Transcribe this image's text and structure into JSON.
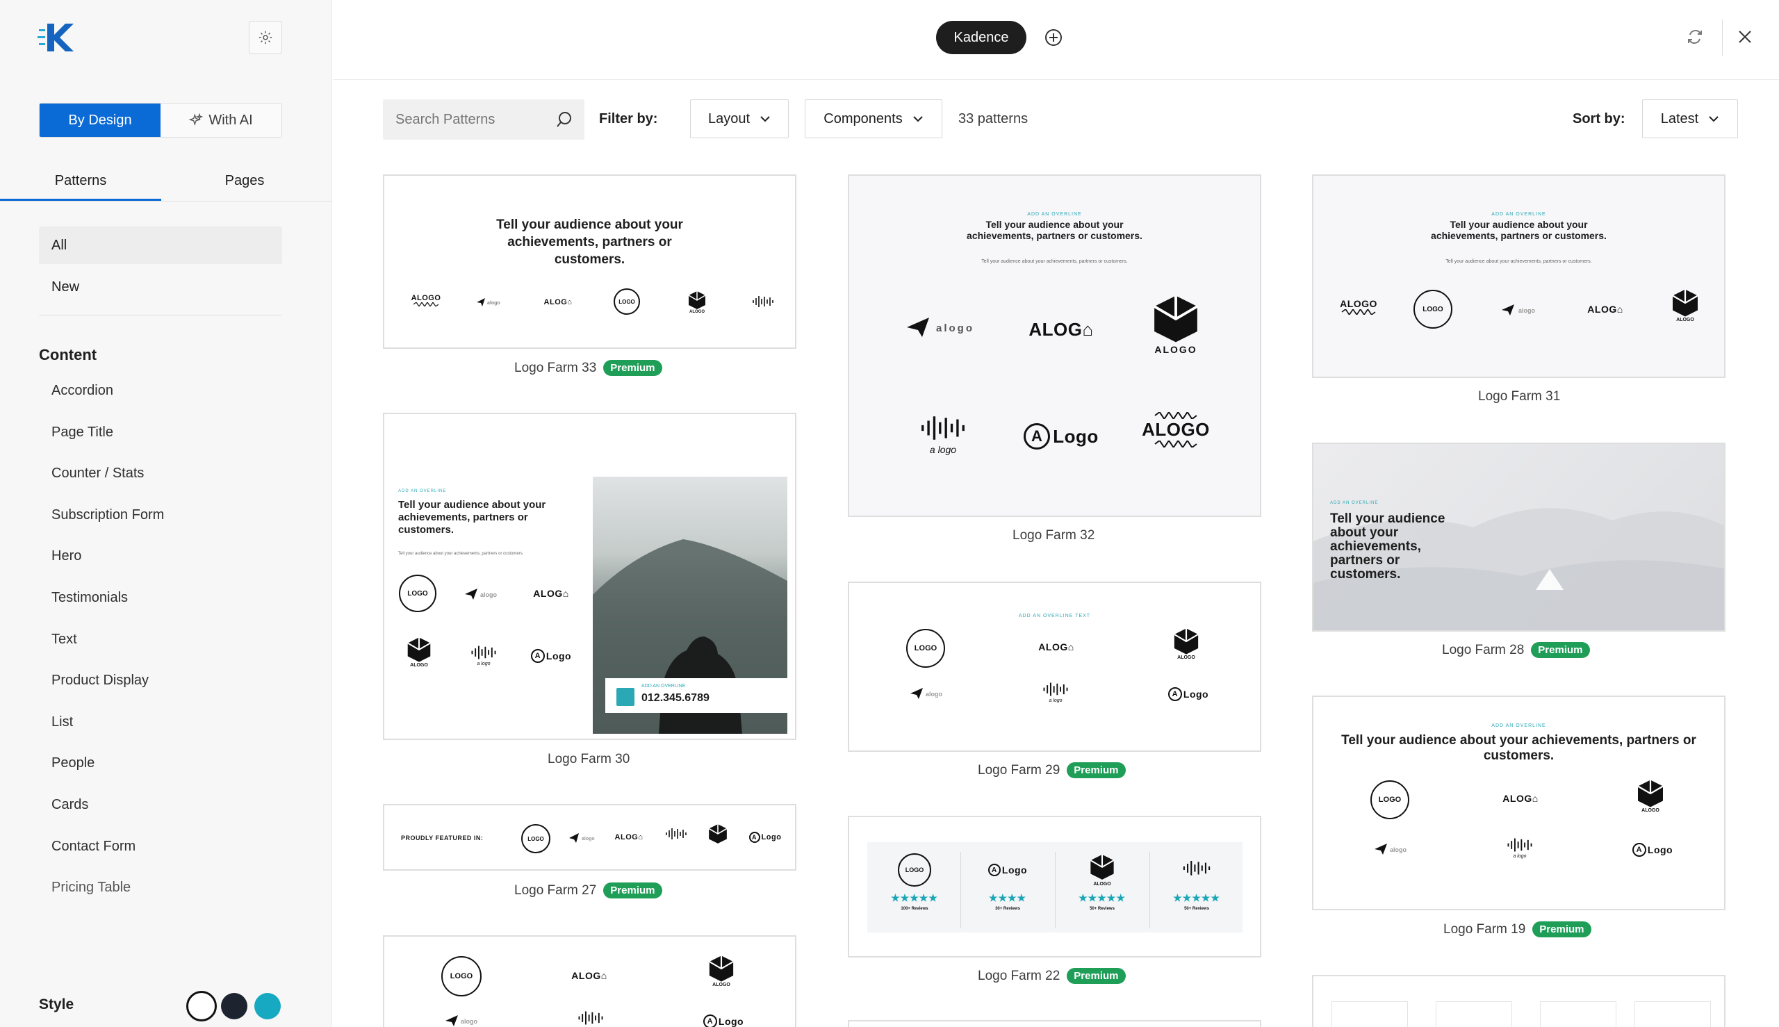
{
  "sidebar": {
    "mode_tabs": [
      {
        "label": "By Design"
      },
      {
        "label": "With AI"
      }
    ],
    "tabs": [
      {
        "label": "Patterns"
      },
      {
        "label": "Pages"
      }
    ],
    "categories_top": [
      {
        "label": "All"
      },
      {
        "label": "New"
      }
    ],
    "section_heading": "Content",
    "categories": [
      {
        "label": "Accordion"
      },
      {
        "label": "Page Title"
      },
      {
        "label": "Counter / Stats"
      },
      {
        "label": "Subscription Form"
      },
      {
        "label": "Hero"
      },
      {
        "label": "Testimonials"
      },
      {
        "label": "Text"
      },
      {
        "label": "Product Display"
      },
      {
        "label": "List"
      },
      {
        "label": "People"
      },
      {
        "label": "Cards"
      },
      {
        "label": "Contact Form"
      },
      {
        "label": "Pricing Table"
      }
    ],
    "style_label": "Style",
    "style_swatches": [
      "#ffffff",
      "#1e2330",
      "#17a9c2"
    ]
  },
  "topbar": {
    "brand_label": "Kadence",
    "accent_color": "#0a6ad6"
  },
  "filters": {
    "search_placeholder": "Search Patterns",
    "filter_label": "Filter by:",
    "layout_label": "Layout",
    "components_label": "Components",
    "count_text": "33 patterns",
    "sort_label": "Sort by:",
    "sort_value": "Latest"
  },
  "badge_label": "Premium",
  "preview_text": {
    "headline": "Tell your audience about your achievements, partners or customers.",
    "overline": "ADD AN OVERLINE",
    "overline_text": "ADD AN OVERLINE TEXT",
    "subtext": "Tell your audience about your achievements, partners or customers.",
    "featured": "PROUDLY FEATURED IN:",
    "phone": "012.345.6789",
    "logo": "LOGO",
    "aloge": "ALOG⌂",
    "alogo": "ALOGO",
    "alogo_small": "alogo",
    "a_logo": "a logo",
    "alogo_word": "Logo",
    "reviews": [
      "100+ Reviews",
      "30+ Reviews",
      "50+ Reviews",
      "50+ Reviews"
    ]
  },
  "patterns": [
    {
      "name": "Logo Farm 33",
      "premium": true
    },
    {
      "name": "Logo Farm 32",
      "premium": false
    },
    {
      "name": "Logo Farm 31",
      "premium": false
    },
    {
      "name": "Logo Farm 30",
      "premium": false
    },
    {
      "name": "Logo Farm 29",
      "premium": true
    },
    {
      "name": "Logo Farm 28",
      "premium": true
    },
    {
      "name": "Logo Farm 27",
      "premium": true
    },
    {
      "name": "Logo Farm 22",
      "premium": true
    },
    {
      "name": "Logo Farm 19",
      "premium": true
    }
  ]
}
